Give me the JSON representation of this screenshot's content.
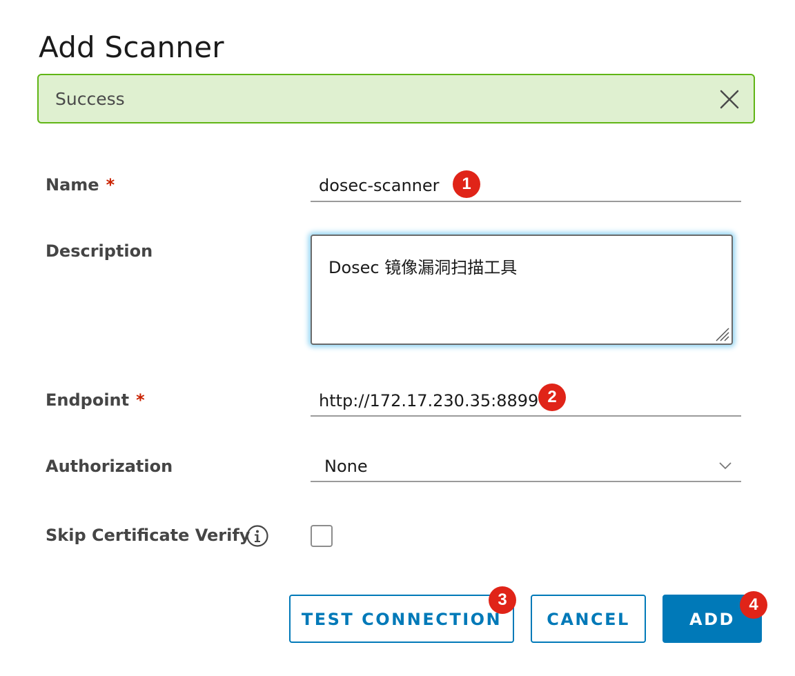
{
  "dialog": {
    "title": "Add Scanner"
  },
  "alert": {
    "message": "Success",
    "close_icon": "close-icon"
  },
  "form": {
    "name": {
      "label": "Name",
      "required_mark": "*",
      "value": "dosec-scanner",
      "badge": "1"
    },
    "description": {
      "label": "Description",
      "value": "Dosec 镜像漏洞扫描工具"
    },
    "endpoint": {
      "label": "Endpoint",
      "required_mark": "*",
      "value": "http://172.17.230.35:8899",
      "badge": "2"
    },
    "authorization": {
      "label": "Authorization",
      "selected": "None"
    },
    "skip_cert": {
      "label": "Skip Certificate Verify",
      "checked": false,
      "info_icon": "info-icon"
    }
  },
  "buttons": {
    "test_connection": {
      "label": "TEST CONNECTION",
      "badge": "3"
    },
    "cancel": {
      "label": "CANCEL"
    },
    "add": {
      "label": "ADD",
      "badge": "4"
    }
  },
  "colors": {
    "accent": "#0079b8",
    "success_bg": "#dff0d0",
    "success_border": "#60b515",
    "required": "#c92100",
    "badge": "#e02418",
    "focus_glow": "#8fd3f2"
  }
}
